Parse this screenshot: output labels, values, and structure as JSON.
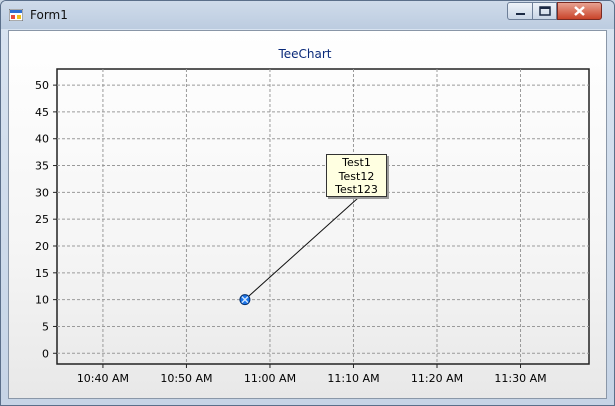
{
  "window": {
    "title": "Form1",
    "icon": "form-icon",
    "controls": [
      "minimize-icon",
      "maximize-icon",
      "close-icon"
    ]
  },
  "chart_data": {
    "type": "scatter",
    "title": "TeeChart",
    "xlabel": "",
    "ylabel": "",
    "x_ticks": [
      "10:40 AM",
      "10:50 AM",
      "11:00 AM",
      "11:10 AM",
      "11:20 AM",
      "11:30 AM"
    ],
    "y_ticks": [
      0,
      5,
      10,
      15,
      20,
      25,
      30,
      35,
      40,
      45,
      50
    ],
    "ylim": [
      -2,
      53
    ],
    "xlim_minutes_after_1040": [
      -5.5,
      58.2
    ],
    "grid": true,
    "series": [
      {
        "points": [
          {
            "x": "10:57 AM",
            "y": 10
          }
        ]
      }
    ],
    "annotation": {
      "lines": [
        "Test1",
        "Test12",
        "Test123"
      ],
      "anchor": {
        "x": "10:57 AM",
        "y": 10
      }
    },
    "colors": {
      "point": "#1a73e8",
      "title": "#0a2a7a",
      "grid": "#9a9a9a"
    }
  }
}
